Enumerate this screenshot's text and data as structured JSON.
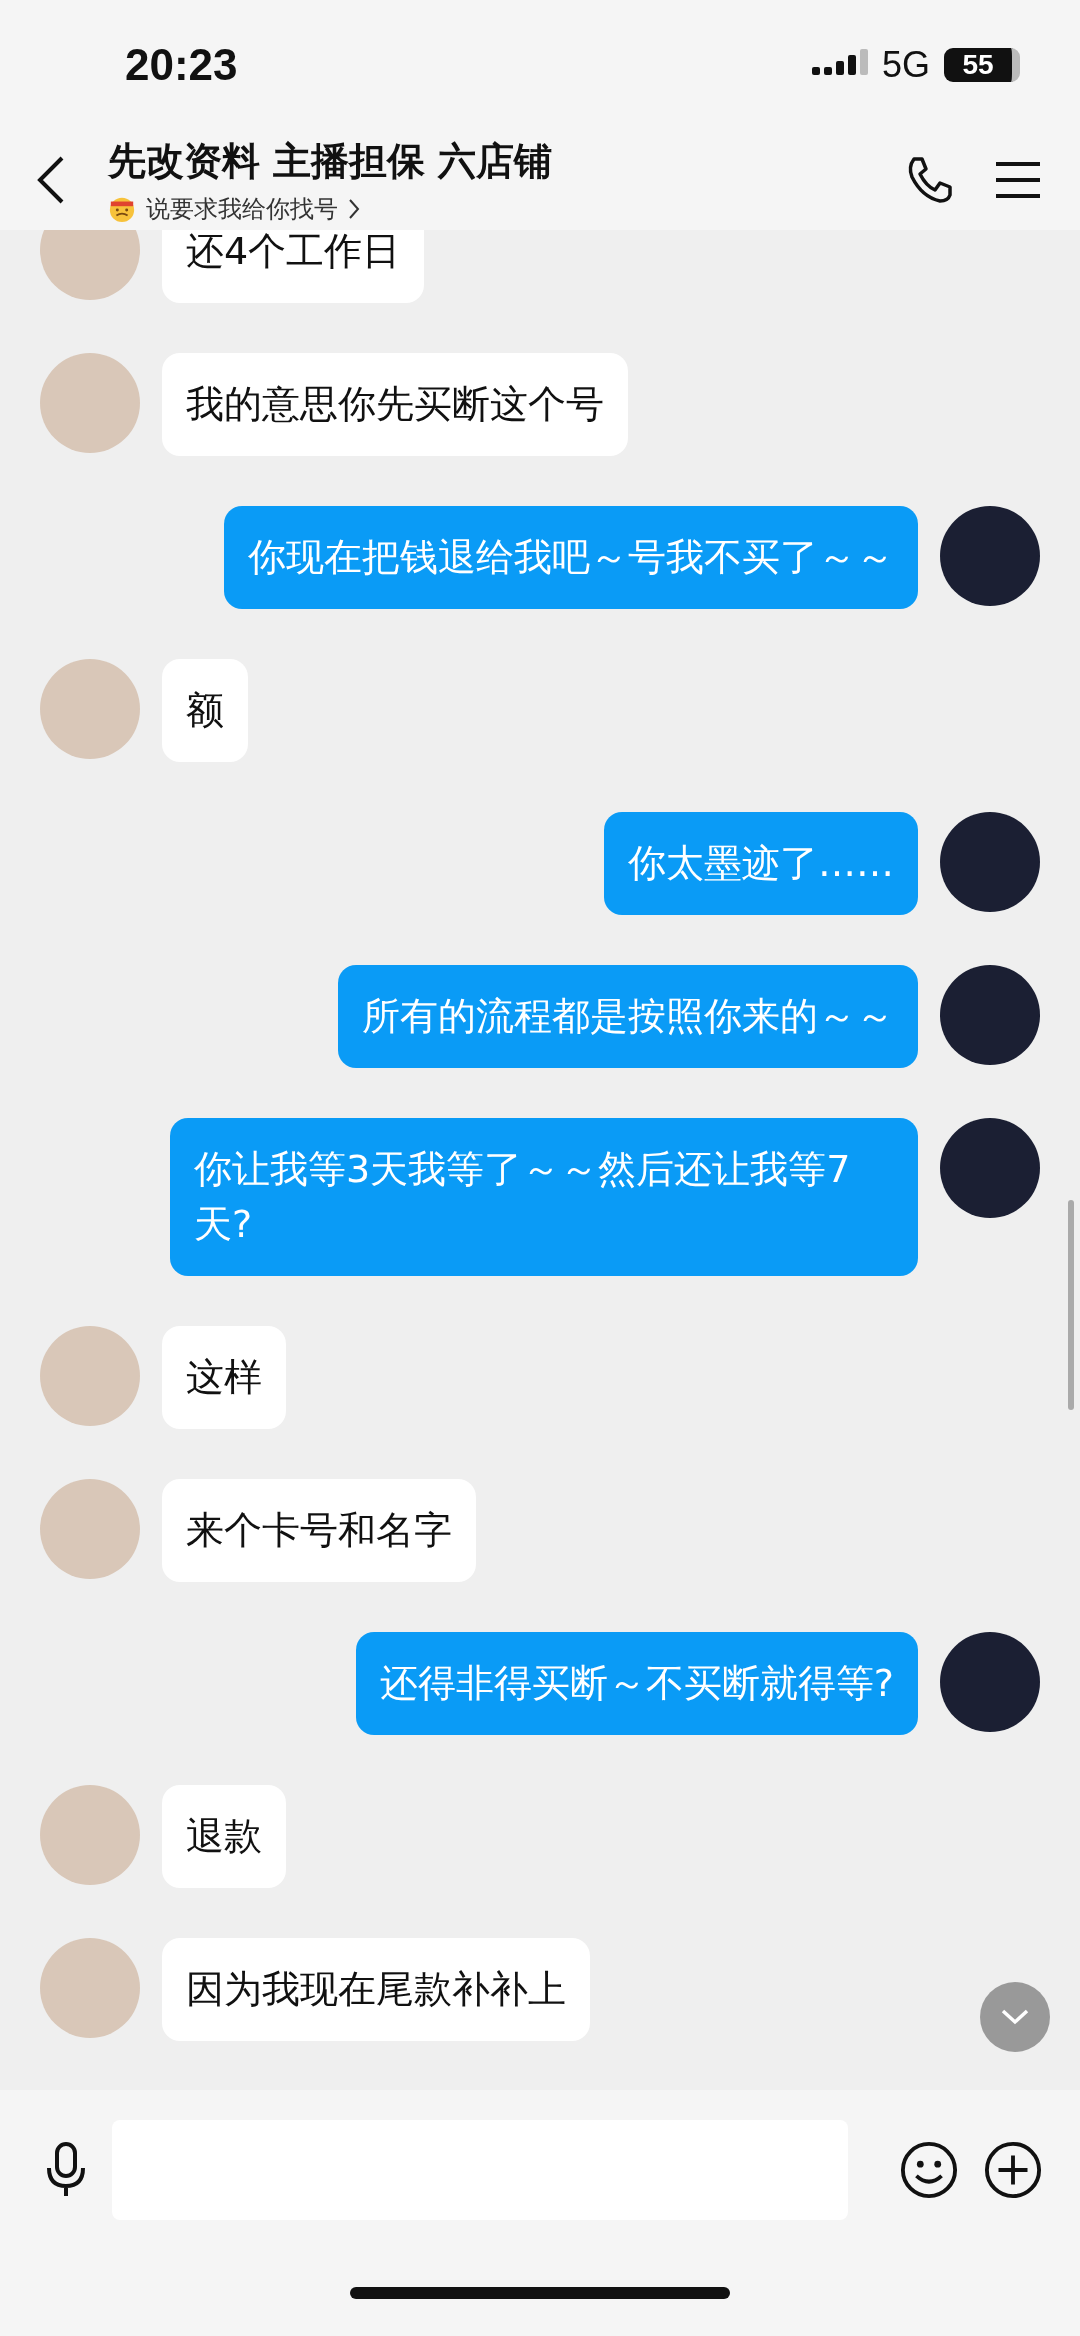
{
  "status_bar": {
    "time": "20:23",
    "network": "5G",
    "battery": "55"
  },
  "header": {
    "title": "先改资料 主播担保 六店铺",
    "subtitle": "说要求我给你找号"
  },
  "messages": [
    {
      "kind": "incoming",
      "text": "还4个工作日"
    },
    {
      "kind": "incoming",
      "text": "我的意思你先买断这个号"
    },
    {
      "kind": "outgoing",
      "text": "你现在把钱退给我吧～号我不买了～～"
    },
    {
      "kind": "incoming",
      "text": "额"
    },
    {
      "kind": "outgoing",
      "text": "你太墨迹了……"
    },
    {
      "kind": "outgoing",
      "text": "所有的流程都是按照你来的～～"
    },
    {
      "kind": "outgoing",
      "text": "你让我等3天我等了～～然后还让我等7天?"
    },
    {
      "kind": "incoming",
      "text": "这样"
    },
    {
      "kind": "incoming",
      "text": "来个卡号和名字"
    },
    {
      "kind": "outgoing",
      "text": "还得非得买断～不买断就得等?"
    },
    {
      "kind": "incoming",
      "text": "退款"
    },
    {
      "kind": "incoming",
      "text": "因为我现在尾款补补上"
    }
  ]
}
